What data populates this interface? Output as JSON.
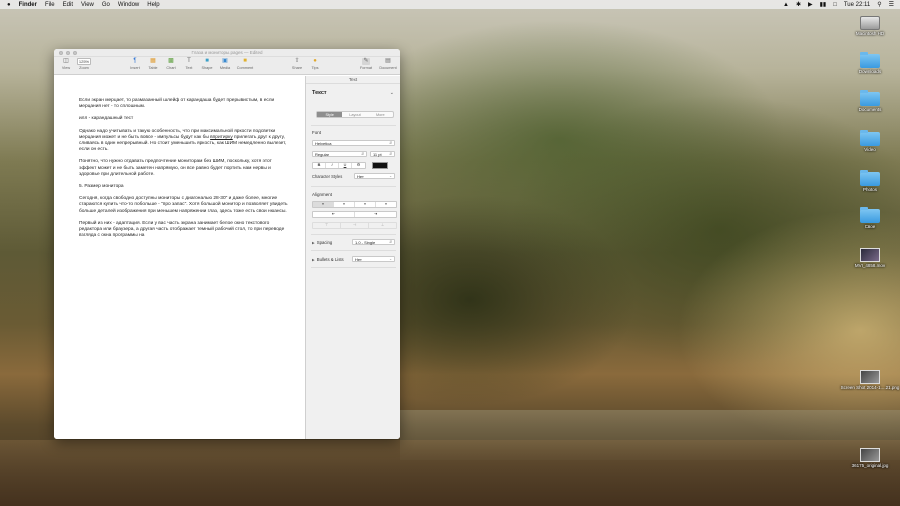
{
  "menubar": {
    "apple": "",
    "app": "Finder",
    "items": [
      "File",
      "Edit",
      "View",
      "Go",
      "Window",
      "Help"
    ],
    "clock": "Tue 22:11"
  },
  "window": {
    "title": "Глаза и мониторы.pages — Edited",
    "toolbar": {
      "view": "View",
      "zoom_value": "125%",
      "zoom": "Zoom",
      "insert": "Insert",
      "table": "Table",
      "chart": "Chart",
      "text": "Text",
      "shape": "Shape",
      "media": "Media",
      "comment": "Comment",
      "share": "Share",
      "tips": "Tips",
      "format": "Format",
      "document": "Document"
    }
  },
  "document": {
    "p1": "Если экран мерцает, то размазанный шлейф от карандаша будет прерывистым, в если мерцания нет - то сплошным.",
    "p2": "илл - карандашный тест",
    "p3a": "Однако надо учитывать и такую особенность, что при максимальной яркости подсветки мерцания может и не быть вовсе - импульсы будут как бы ",
    "p3u": "впритирку",
    "p3b": " прилегать друг к другу, сливаясь в один непрерывный. Но стоит уменьшить яркость, как ШИМ немедленно вылезет, если он есть.",
    "p4": "Понятно, что нужно отдавать предпочтение мониторам без ШИМ, поскольку, хотя этот эффект может и не быть заметен напрямую, он все равно будет портить нам нервы и здоровье при длительной работе.",
    "p5": "5. Размер монитора",
    "p6": "Сегодня, когда свободно доступны мониторы с диагональю 28-30\" и даже более, многие стараются купить что-то побольше - \"про запас\". Хотя большой монитор и позволяет увидеть больше деталей изображения при меньшем напряжении глаз, здесь тоже есть свои нюансы.",
    "p7": "Первый из них - адаптация. Если у вас часть экрана занимает белое окно текстового редактора или браузера, а другая часть отображает темный рабочий стол, то при переводе взгляда с окна программы на"
  },
  "inspector": {
    "header": "Text",
    "section": "Текст",
    "tabs": [
      "Style",
      "Layout",
      "More"
    ],
    "font_label": "Font",
    "font_family": "Helvetica",
    "font_style": "Regular",
    "font_size": "11 pt",
    "bold": "B",
    "italic": "I",
    "underline": "U",
    "gear": "⚙",
    "char_styles_label": "Character Styles",
    "char_styles_value": "Нет",
    "alignment_label": "Alignment",
    "indent_less": "⇤",
    "indent_more": "⇥",
    "spacing_label": "Spacing",
    "spacing_value": "1.0 - Single",
    "bullets_label": "Bullets & Lists",
    "bullets_value": "Нет",
    "text_color": "#111111"
  },
  "desktop_icons": [
    {
      "name": "Macintosh HD",
      "kind": "hd"
    },
    {
      "name": "Downloads",
      "kind": "folder"
    },
    {
      "name": "Documents",
      "kind": "folder"
    },
    {
      "name": "Video",
      "kind": "folder"
    },
    {
      "name": "Photos",
      "kind": "folder"
    },
    {
      "name": "Свое",
      "kind": "folder"
    },
    {
      "name": "MVI_4858.mov",
      "kind": "video"
    },
    {
      "name": "Screen Shot 2014-1....21.png",
      "kind": "image"
    },
    {
      "name": "36175_original.jpg",
      "kind": "image"
    }
  ]
}
